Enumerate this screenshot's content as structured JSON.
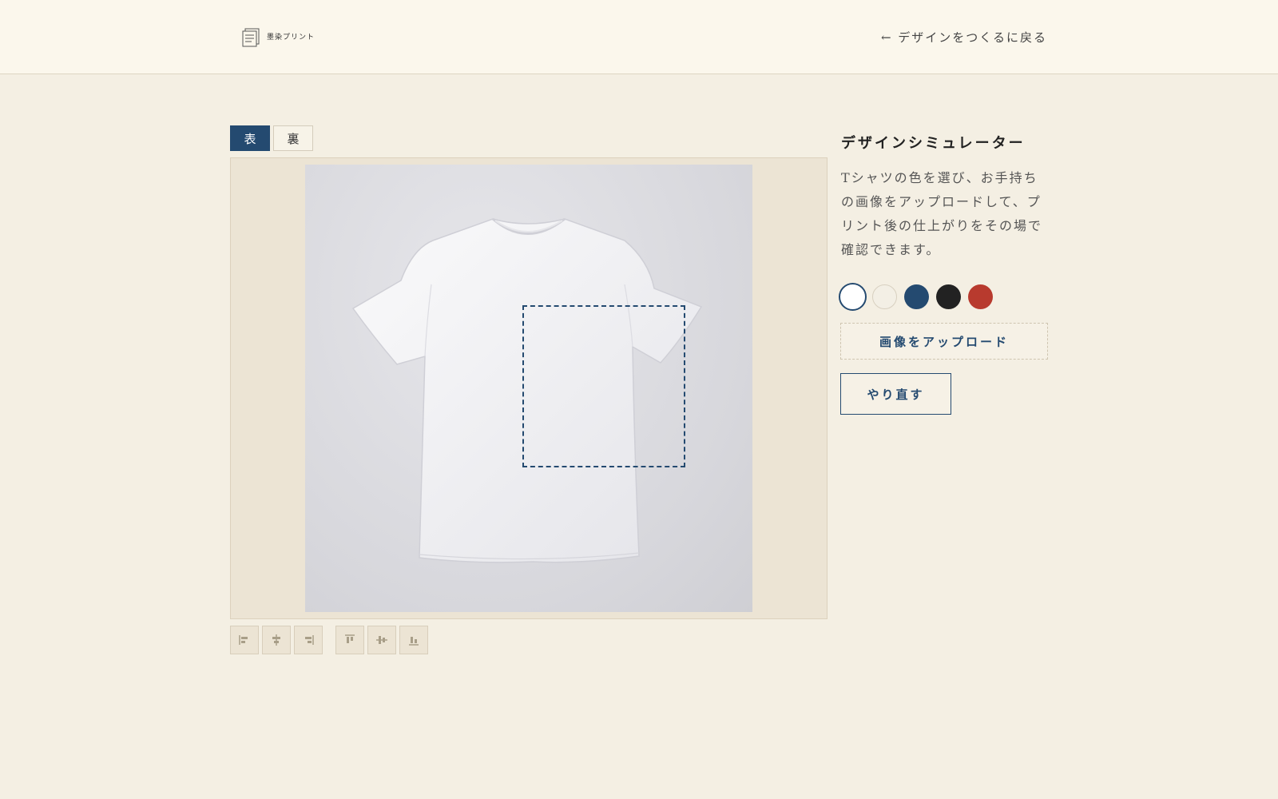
{
  "header": {
    "logo_text": "墨染プリント",
    "back_link": "← デザインをつくるに戻る"
  },
  "tabs": [
    {
      "label": "表",
      "active": true
    },
    {
      "label": "裏",
      "active": false
    }
  ],
  "side": {
    "title": "デザインシミュレーター",
    "description": "Tシャツの色を選び、お手持ちの画像をアップロードして、プリント後の仕上がりをその場で確認できます。"
  },
  "colors": [
    {
      "name": "white",
      "hex": "#ffffff",
      "selected": true
    },
    {
      "name": "ivory",
      "hex": "#f3efe5",
      "selected": false
    },
    {
      "name": "navy",
      "hex": "#244a70",
      "selected": false
    },
    {
      "name": "black",
      "hex": "#222222",
      "selected": false
    },
    {
      "name": "red",
      "hex": "#b83a2e",
      "selected": false
    }
  ],
  "buttons": {
    "upload": "画像をアップロード",
    "redo": "やり直す"
  },
  "align_tools": [
    "align-left-icon",
    "align-center-horizontal-icon",
    "align-right-icon",
    "align-top-icon",
    "align-center-vertical-icon",
    "align-bottom-icon"
  ],
  "accent_color": "#244a70"
}
